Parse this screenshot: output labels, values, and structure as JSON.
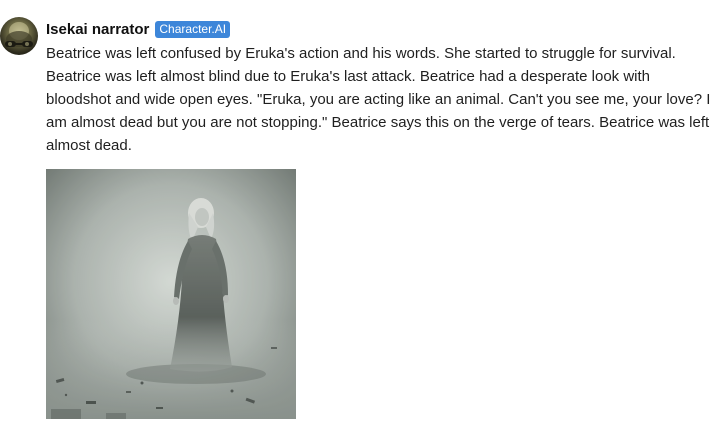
{
  "message": {
    "author": "Isekai narrator",
    "badge": "Character.AI",
    "avatar_icon": "character-avatar-icon",
    "text": "Beatrice was left confused by Eruka's action and his words. She started to struggle for survival. Beatrice was left almost blind due to Eruka's last attack. Beatrice had a desperate look with bloodshot and wide open eyes. \"Eruka, you are acting like an animal. Can't you see me, your love? I am almost dead but you are not stopping.\" Beatrice says this on the verge of tears. Beatrice was left almost dead.",
    "image": {
      "icon": "generated-image",
      "colors": {
        "background_light": "#c9cec9",
        "background_dark": "#6a716c",
        "figure_dress": "#4c524e",
        "hair": "#d8dad6"
      }
    }
  },
  "colors": {
    "badge_bg": "#3d86d9",
    "text": "#1f1f1f"
  }
}
